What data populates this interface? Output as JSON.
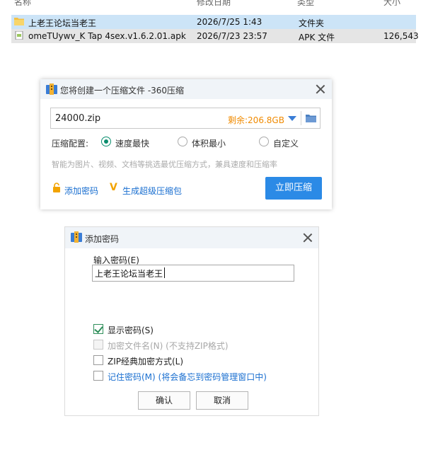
{
  "explorer": {
    "columns": [
      "名称",
      "修改日期",
      "类型",
      "大小"
    ],
    "files": [
      {
        "name": "上老王论坛当老王",
        "date": "2026/7/25 1:43",
        "type": "文件夹",
        "size": ""
      },
      {
        "name": "omeTUywv_K Tap 4sex.v1.6.2.01.apk",
        "date": "2026/7/23 23:57",
        "type": "APK 文件",
        "size": "126,543"
      }
    ]
  },
  "compress_dialog": {
    "title": "您将创建一个压缩文件 -360压缩",
    "archive_name": "24000.zip",
    "remaining_space": "剩余:206.8GB",
    "config_label": "压缩配置:",
    "options": [
      "速度最快",
      "体积最小",
      "自定义"
    ],
    "selected_option": "速度最快",
    "hint": "智能为图片、视频、文档等挑选最优压缩方式，兼具速度和压缩率",
    "add_password_link": "添加密码",
    "super_package_link": "生成超级压缩包",
    "compress_button": "立即压缩"
  },
  "password_dialog": {
    "title": "添加密码",
    "input_label": "输入密码(E)",
    "password_value": "上老王论坛当老王",
    "checkboxes": [
      {
        "label": "显示密码(S)",
        "checked": true,
        "disabled": false
      },
      {
        "label": "加密文件名(N) (不支持ZIP格式)",
        "checked": false,
        "disabled": true
      },
      {
        "label": "ZIP经典加密方式(L)",
        "checked": false,
        "disabled": false
      },
      {
        "label": "记住密码(M) (将会备忘到密码管理窗口中)",
        "checked": false,
        "disabled": false
      }
    ],
    "ok_button": "确认",
    "cancel_button": "取消"
  },
  "colors": {
    "accent_blue": "#2b8ae6",
    "remain_orange": "#f08a00",
    "radio_green": "#0a8d6e"
  }
}
